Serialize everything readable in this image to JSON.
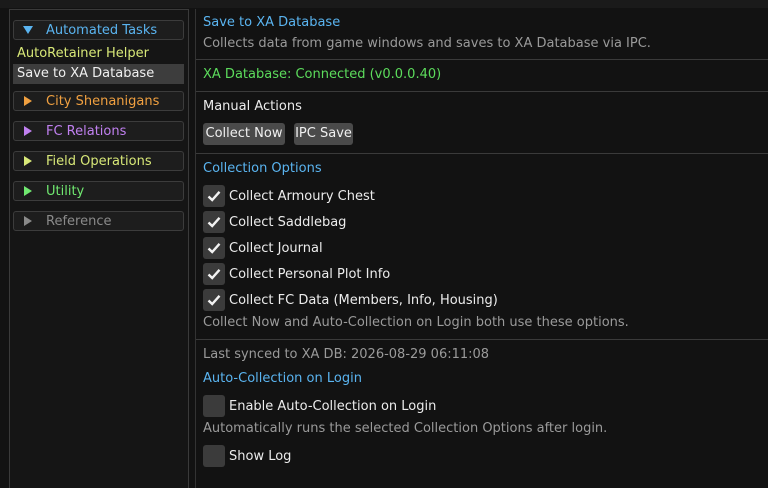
{
  "colors": {
    "accent_blue": "#5ab4f0",
    "connected_green": "#5cdc5c",
    "city_orange": "#f0a040",
    "fc_purple": "#c080f0",
    "field_yellow": "#d8e878",
    "utility_green": "#70e870",
    "reference_gray": "#8a8a8a",
    "muted_text": "#9a9a9a"
  },
  "sidebar": {
    "categories": [
      {
        "label": "Automated Tasks",
        "expanded": true,
        "icon": "triangle-down-icon"
      },
      {
        "label": "City Shenanigans",
        "expanded": false,
        "icon": "triangle-right-icon"
      },
      {
        "label": "FC Relations",
        "expanded": false,
        "icon": "triangle-right-icon"
      },
      {
        "label": "Field Operations",
        "expanded": false,
        "icon": "triangle-right-icon"
      },
      {
        "label": "Utility",
        "expanded": false,
        "icon": "triangle-right-icon"
      },
      {
        "label": "Reference",
        "expanded": false,
        "icon": "triangle-right-icon"
      }
    ],
    "subitems": [
      {
        "label": "AutoRetainer Helper",
        "selected": false
      },
      {
        "label": "Save to XA Database",
        "selected": true
      }
    ]
  },
  "main": {
    "title": "Save to XA Database",
    "description": "Collects data from game windows and saves to XA Database via IPC.",
    "status": "XA Database: Connected (v0.0.0.40)",
    "manual_actions_label": "Manual Actions",
    "buttons": {
      "collect_now": "Collect Now",
      "ipc_save": "IPC Save"
    },
    "collection_options_header": "Collection Options",
    "options": [
      {
        "label": "Collect Armoury Chest",
        "checked": true
      },
      {
        "label": "Collect Saddlebag",
        "checked": true
      },
      {
        "label": "Collect Journal",
        "checked": true
      },
      {
        "label": "Collect Personal Plot Info",
        "checked": true
      },
      {
        "label": "Collect FC Data (Members, Info, Housing)",
        "checked": true
      }
    ],
    "options_note": "Collect Now and Auto-Collection on Login both use these options.",
    "last_synced": "Last synced to XA DB: 2026-08-29 06:11:08",
    "auto_collection_header": "Auto-Collection on Login",
    "enable_auto": {
      "label": "Enable Auto-Collection on Login",
      "checked": false
    },
    "auto_note": "Automatically runs the selected Collection Options after login.",
    "show_log": {
      "label": "Show Log",
      "checked": false
    }
  }
}
